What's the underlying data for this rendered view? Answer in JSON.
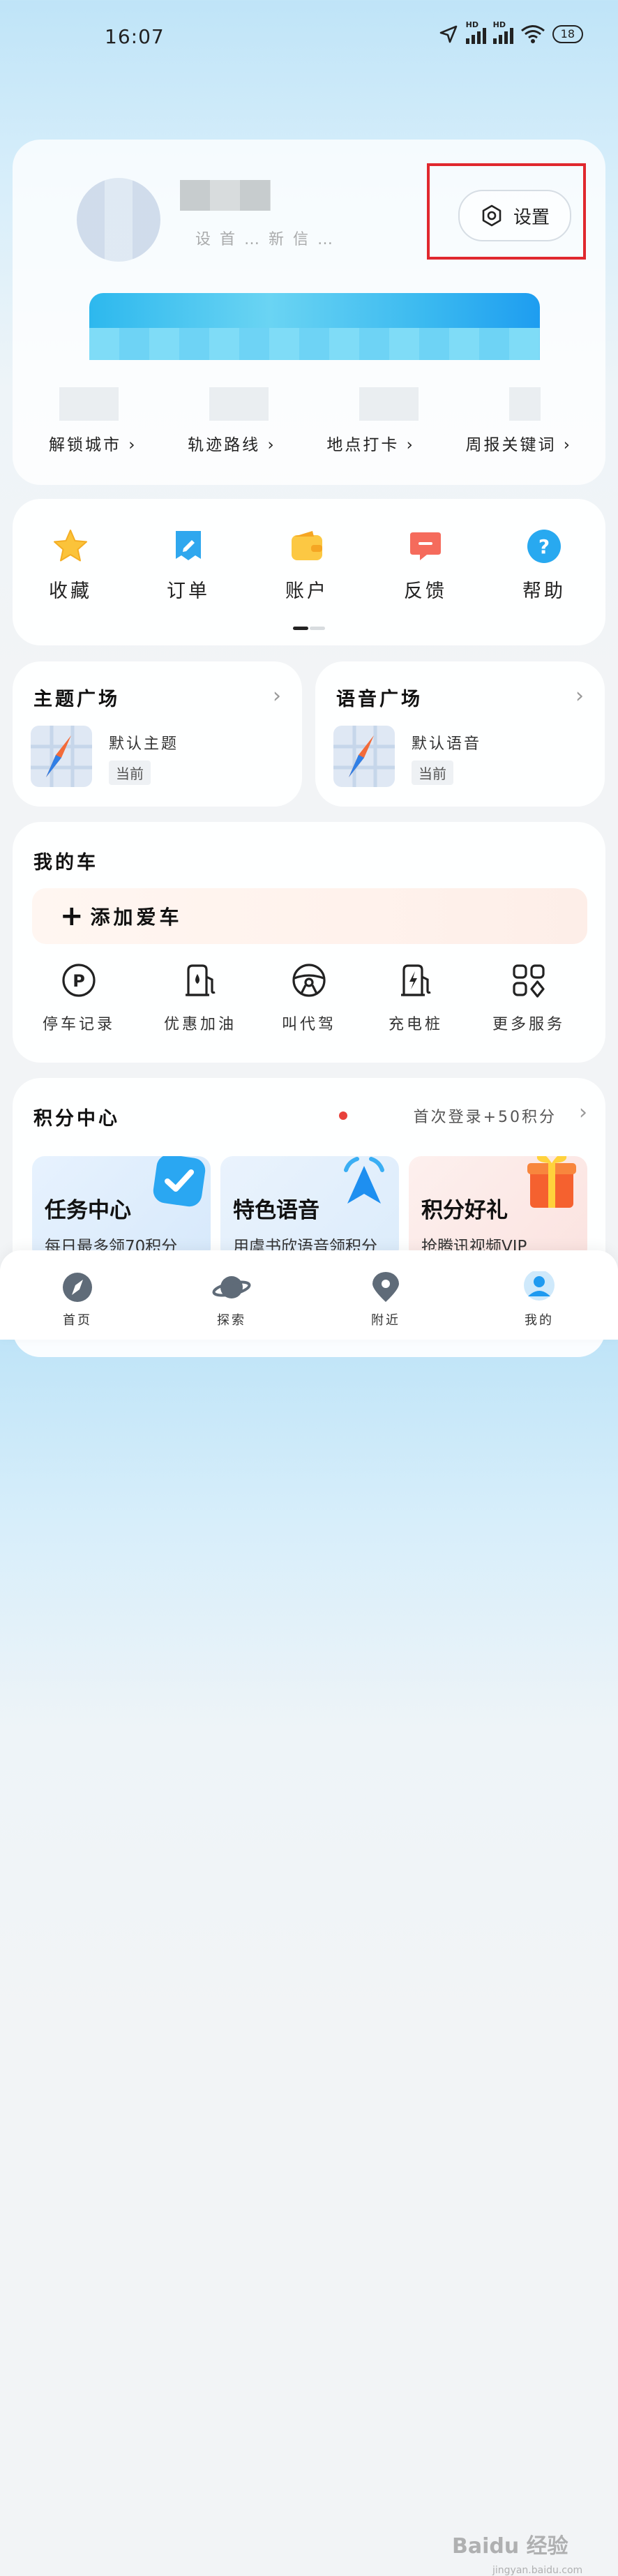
{
  "status_bar": {
    "time": "16:07",
    "battery": "18",
    "hd": "HD"
  },
  "profile": {
    "settings_label": "设置",
    "blurred_hint": "设 首 … 新 信 …",
    "stats": [
      "解锁城市 ›",
      "轨迹路线 ›",
      "地点打卡 ›",
      "周报关键词 ›"
    ]
  },
  "quick_actions": [
    {
      "label": "收藏",
      "icon": "star-icon"
    },
    {
      "label": "订单",
      "icon": "order-icon"
    },
    {
      "label": "账户",
      "icon": "wallet-icon"
    },
    {
      "label": "反馈",
      "icon": "feedback-icon"
    },
    {
      "label": "帮助",
      "icon": "help-icon"
    }
  ],
  "theme_plaza": {
    "title": "主题广场",
    "item": "默认主题",
    "badge": "当前"
  },
  "voice_plaza": {
    "title": "语音广场",
    "item": "默认语音",
    "badge": "当前"
  },
  "my_car": {
    "title": "我的车",
    "add_label": "添加爱车",
    "services": [
      {
        "label": "停车记录",
        "icon": "parking-icon"
      },
      {
        "label": "优惠加油",
        "icon": "fuel-icon"
      },
      {
        "label": "叫代驾",
        "icon": "steering-wheel-icon"
      },
      {
        "label": "充电桩",
        "icon": "charger-icon"
      },
      {
        "label": "更多服务",
        "icon": "more-services-icon"
      }
    ]
  },
  "points": {
    "title": "积分中心",
    "promo": "首次登录+50积分",
    "cards": [
      {
        "title": "任务中心",
        "sub": "每日最多领70积分",
        "color": "#e3f0fd"
      },
      {
        "title": "特色语音",
        "sub": "用虞书欣语音领积分",
        "color": "#e4effb"
      },
      {
        "title": "积分好礼",
        "sub": "抢腾讯视频VIP",
        "color": "#fdecea"
      }
    ]
  },
  "nav": [
    {
      "label": "首页",
      "icon": "compass-icon"
    },
    {
      "label": "探索",
      "icon": "planet-icon"
    },
    {
      "label": "附近",
      "icon": "location-pin-icon"
    },
    {
      "label": "我的",
      "icon": "user-icon"
    }
  ],
  "watermark": {
    "main": "Baidu 经验",
    "sub": "jingyan.baidu.com"
  },
  "colors": {
    "accent": "#1fa6f0",
    "highlight_box": "#e0282e"
  }
}
